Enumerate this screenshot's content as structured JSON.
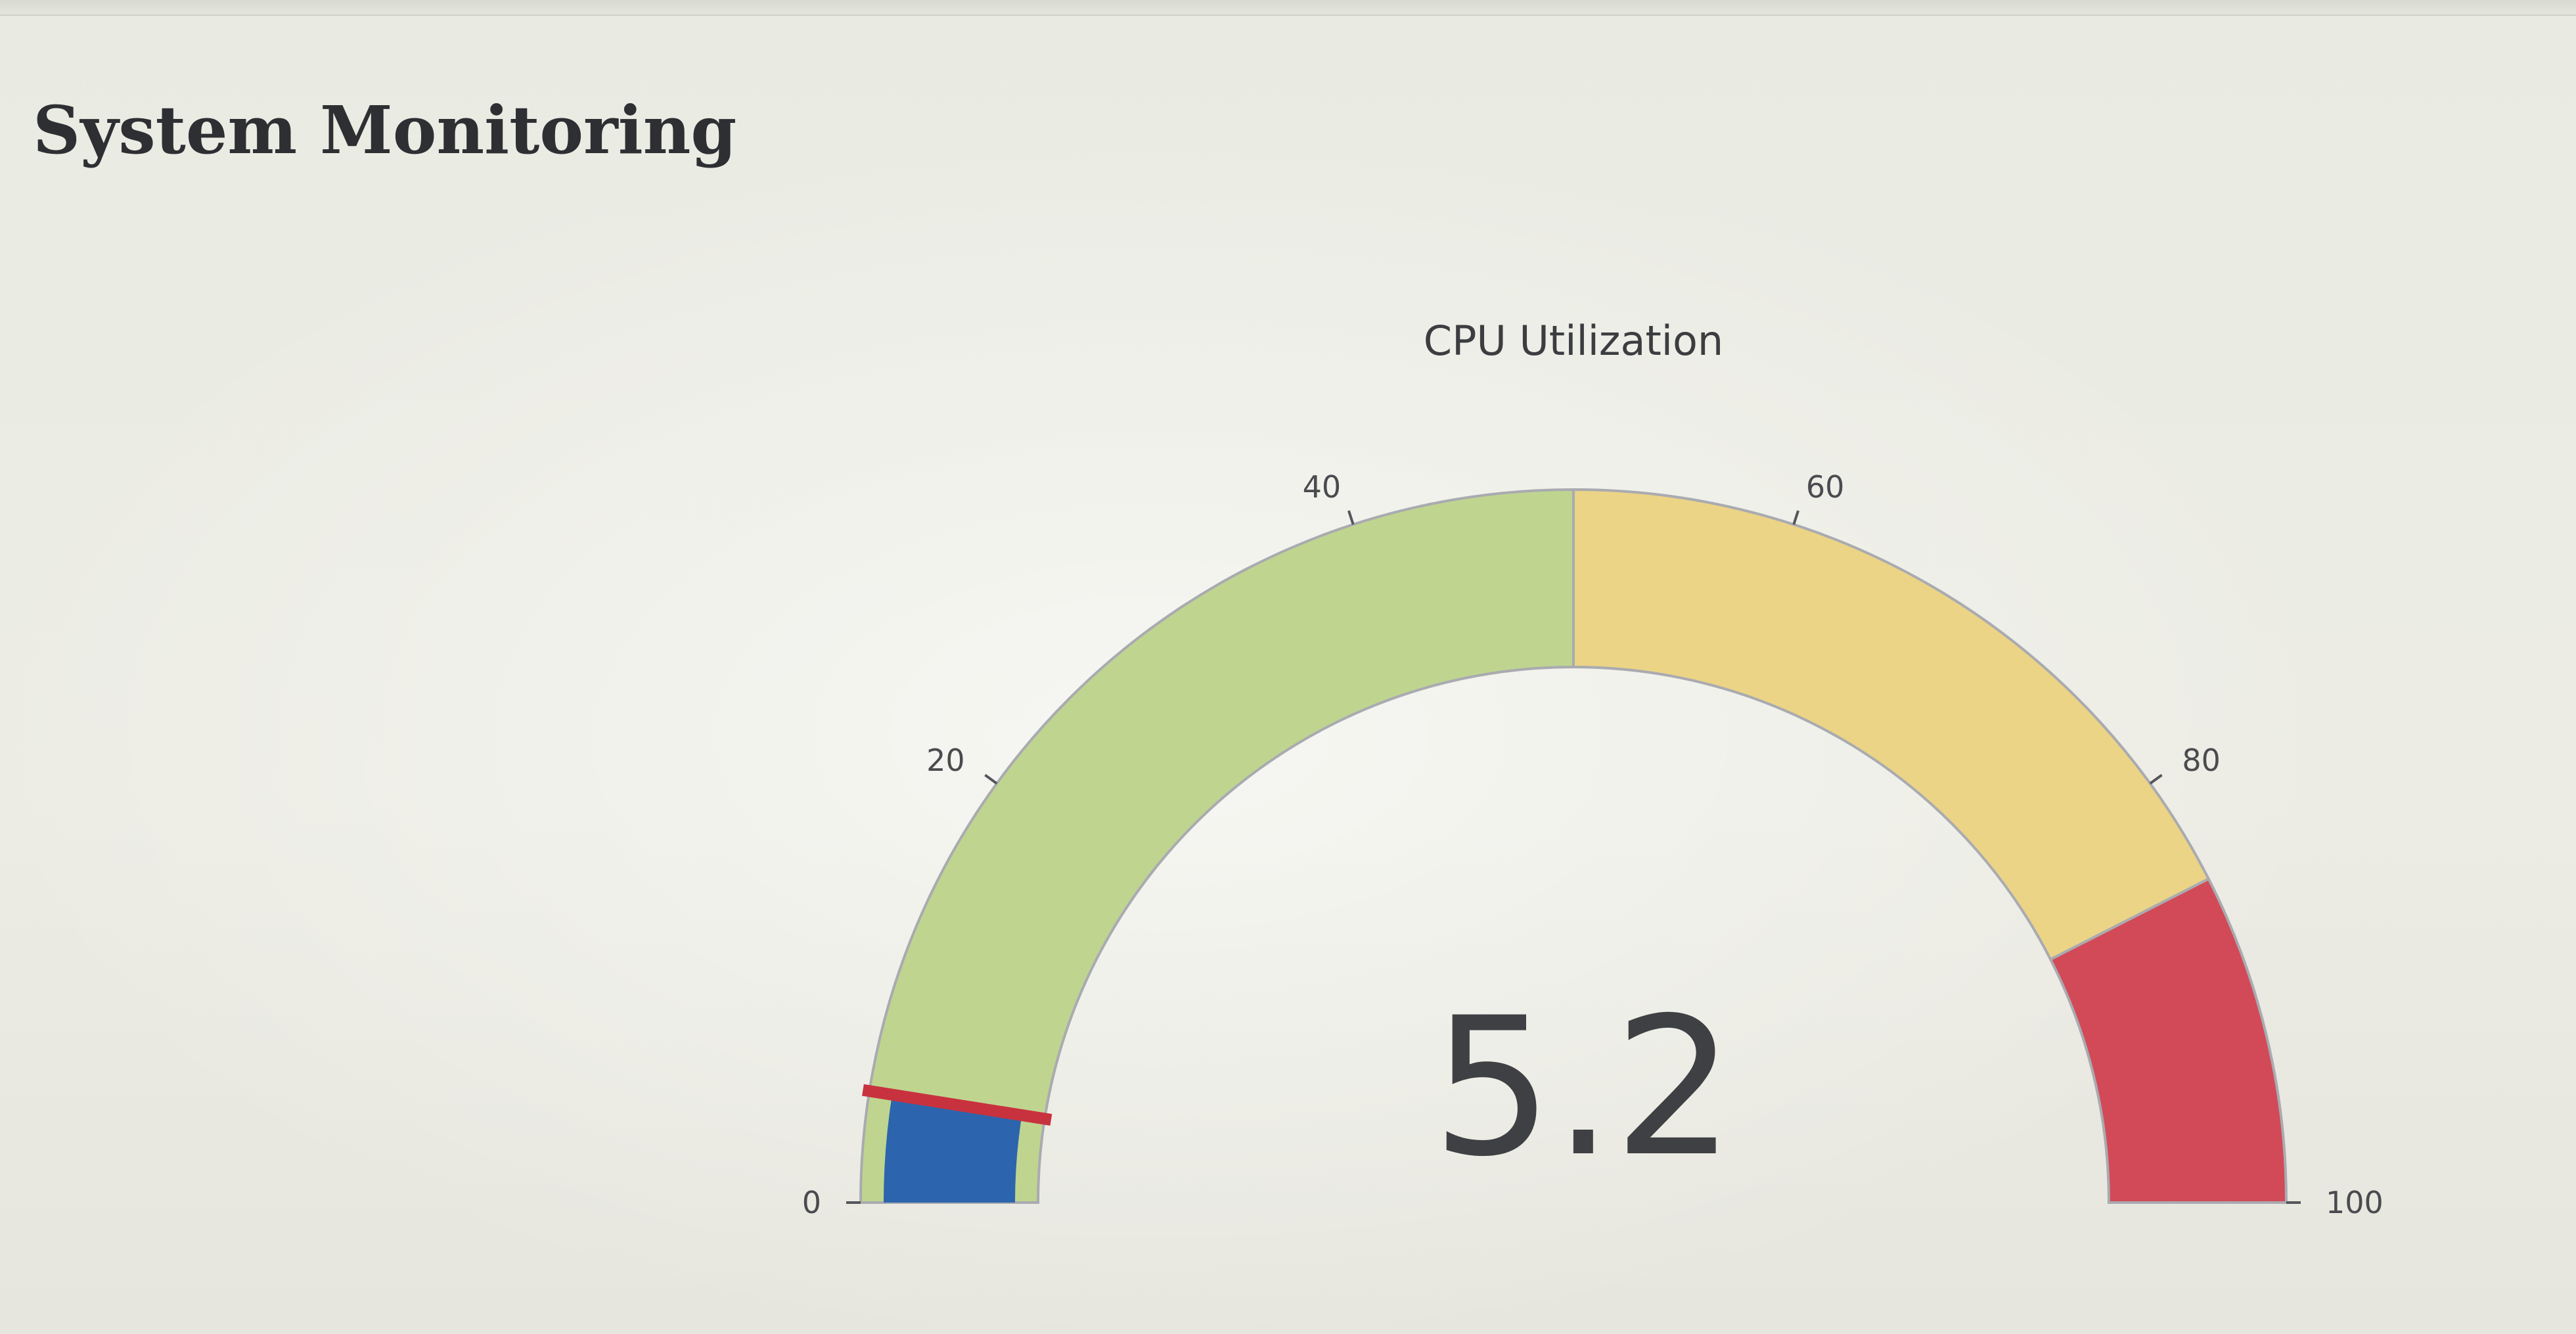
{
  "page": {
    "title": "System Monitoring"
  },
  "chart_data": {
    "type": "gauge",
    "title": "CPU Utilization",
    "value": 5.2,
    "value_label": "5.2",
    "range": [
      0,
      100
    ],
    "threshold": 5,
    "ticks": [
      0,
      20,
      40,
      60,
      80,
      100
    ],
    "tick_labels": [
      "0",
      "20",
      "40",
      "60",
      "80",
      "100"
    ],
    "steps": [
      {
        "range": [
          0,
          50
        ],
        "color": "#bfd58f"
      },
      {
        "range": [
          50,
          85
        ],
        "color": "#ecd486"
      },
      {
        "range": [
          85,
          100
        ],
        "color": "#d24a57"
      }
    ],
    "bar_color": "#2c65ad",
    "threshold_color": "#c8323e"
  }
}
